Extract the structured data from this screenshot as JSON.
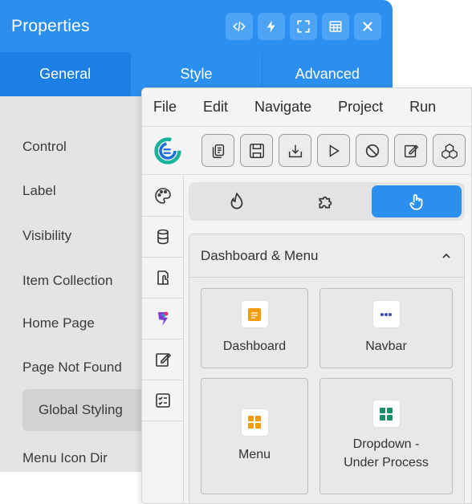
{
  "properties": {
    "title": "Properties",
    "header_icons": [
      "code-icon",
      "lightning-icon",
      "fullscreen-icon",
      "table-icon",
      "close-icon"
    ],
    "tabs": [
      {
        "label": "General",
        "active": true
      },
      {
        "label": "Style",
        "active": false
      },
      {
        "label": "Advanced",
        "active": false
      }
    ],
    "items": [
      {
        "label": "Control"
      },
      {
        "label": "Label"
      },
      {
        "label": "Visibility"
      },
      {
        "label": "Item Collection"
      },
      {
        "label": "Home Page"
      },
      {
        "label": "Page Not Found"
      },
      {
        "label": "Global Styling",
        "selected": true
      },
      {
        "label": "Menu Icon Dir"
      }
    ]
  },
  "ide": {
    "menu": [
      "File",
      "Edit",
      "Navigate",
      "Project",
      "Run"
    ],
    "toolbar_icons": [
      "copy-icon",
      "save-icon",
      "download-icon",
      "play-icon",
      "stop-icon",
      "edit-icon",
      "blocks-icon"
    ],
    "sidebar_icons": [
      "palette-icon",
      "database-icon",
      "document-hand-icon",
      "plugin-icon",
      "edit-icon",
      "checklist-icon"
    ],
    "mode_icons": [
      "drop-icon",
      "puzzle-icon",
      "touch-icon"
    ],
    "active_mode": 2,
    "section": {
      "title": "Dashboard & Menu",
      "collapse_icon": "chevron-up-icon",
      "components": [
        {
          "label": "Dashboard",
          "icon": "dashboard-icon",
          "color": "#f39c12"
        },
        {
          "label": "Navbar",
          "icon": "navbar-icon",
          "color": "#3b4cc0"
        },
        {
          "label": "Menu",
          "icon": "menu-grid-icon",
          "color": "#f39c12"
        },
        {
          "label": "Dropdown - Under Process",
          "icon": "dropdown-grid-icon",
          "color": "#1a8f6b"
        }
      ]
    }
  },
  "colors": {
    "accent": "#2b8ff0",
    "accent_dark": "#1b7fe3",
    "panel_bg": "#e4e4e4"
  }
}
